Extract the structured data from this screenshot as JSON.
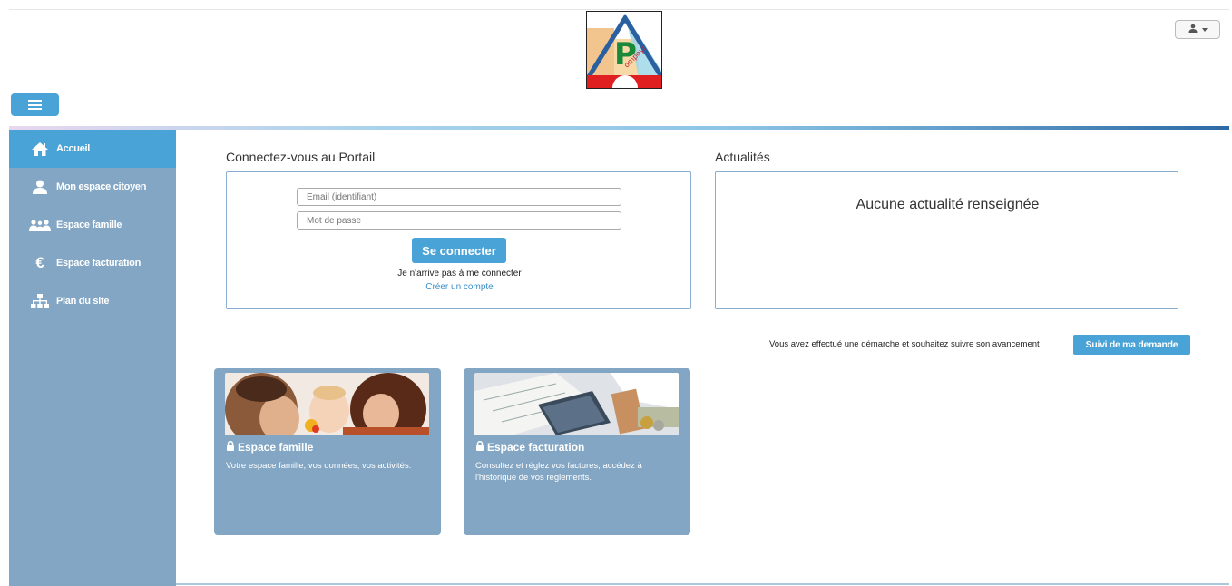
{
  "header": {
    "user_menu_icon": "user-icon",
    "user_menu_caret": "caret-down-icon",
    "menu_toggle_icon": "hamburger-icon"
  },
  "sidebar": {
    "items": [
      {
        "label": "Accueil",
        "icon": "home-icon",
        "active": true
      },
      {
        "label": "Mon espace citoyen",
        "icon": "user-icon",
        "active": false
      },
      {
        "label": "Espace famille",
        "icon": "family-icon",
        "active": false
      },
      {
        "label": "Espace facturation",
        "icon": "euro-icon",
        "active": false
      },
      {
        "label": "Plan du site",
        "icon": "sitemap-icon",
        "active": false
      }
    ]
  },
  "login": {
    "title": "Connectez-vous au Portail",
    "email_placeholder": "Email (identifiant)",
    "password_placeholder": "Mot de passe",
    "submit_label": "Se connecter",
    "help_text": "Je n'arrive pas à me connecter",
    "create_account_label": "Créer un compte"
  },
  "news": {
    "title": "Actualités",
    "empty_message": "Aucune actualité renseignée"
  },
  "tracking": {
    "text": "Vous avez effectué une démarche et souhaitez suivre son avancement",
    "button_label": "Suivi de ma demande"
  },
  "cards": [
    {
      "title": "Espace famille",
      "description": "Votre espace famille, vos données, vos activités.",
      "icon": "lock-icon"
    },
    {
      "title": "Espace facturation",
      "description": "Consultez et réglez vos factures, accédez à l'historique de vos règlements.",
      "icon": "lock-icon"
    }
  ],
  "colors": {
    "accent": "#4aa3d6",
    "sidebar_bg": "#82a6c4",
    "link": "#3a8fc8",
    "box_border": "#8aaed0"
  }
}
